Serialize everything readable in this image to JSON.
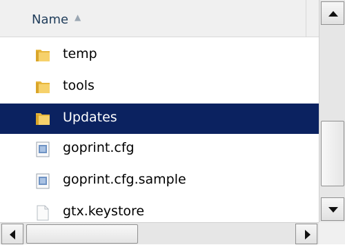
{
  "header": {
    "column_name": "Name",
    "sort_indicator": "▲"
  },
  "files": [
    {
      "name": "temp",
      "type": "folder",
      "selected": false
    },
    {
      "name": "tools",
      "type": "folder",
      "selected": false
    },
    {
      "name": "Updates",
      "type": "folder",
      "selected": true
    },
    {
      "name": "goprint.cfg",
      "type": "config",
      "selected": false
    },
    {
      "name": "goprint.cfg.sample",
      "type": "config",
      "selected": false
    },
    {
      "name": "gtx.keystore",
      "type": "file",
      "selected": false
    }
  ],
  "colors": {
    "selection": "#0b2260",
    "folder": "#f2c94c"
  }
}
